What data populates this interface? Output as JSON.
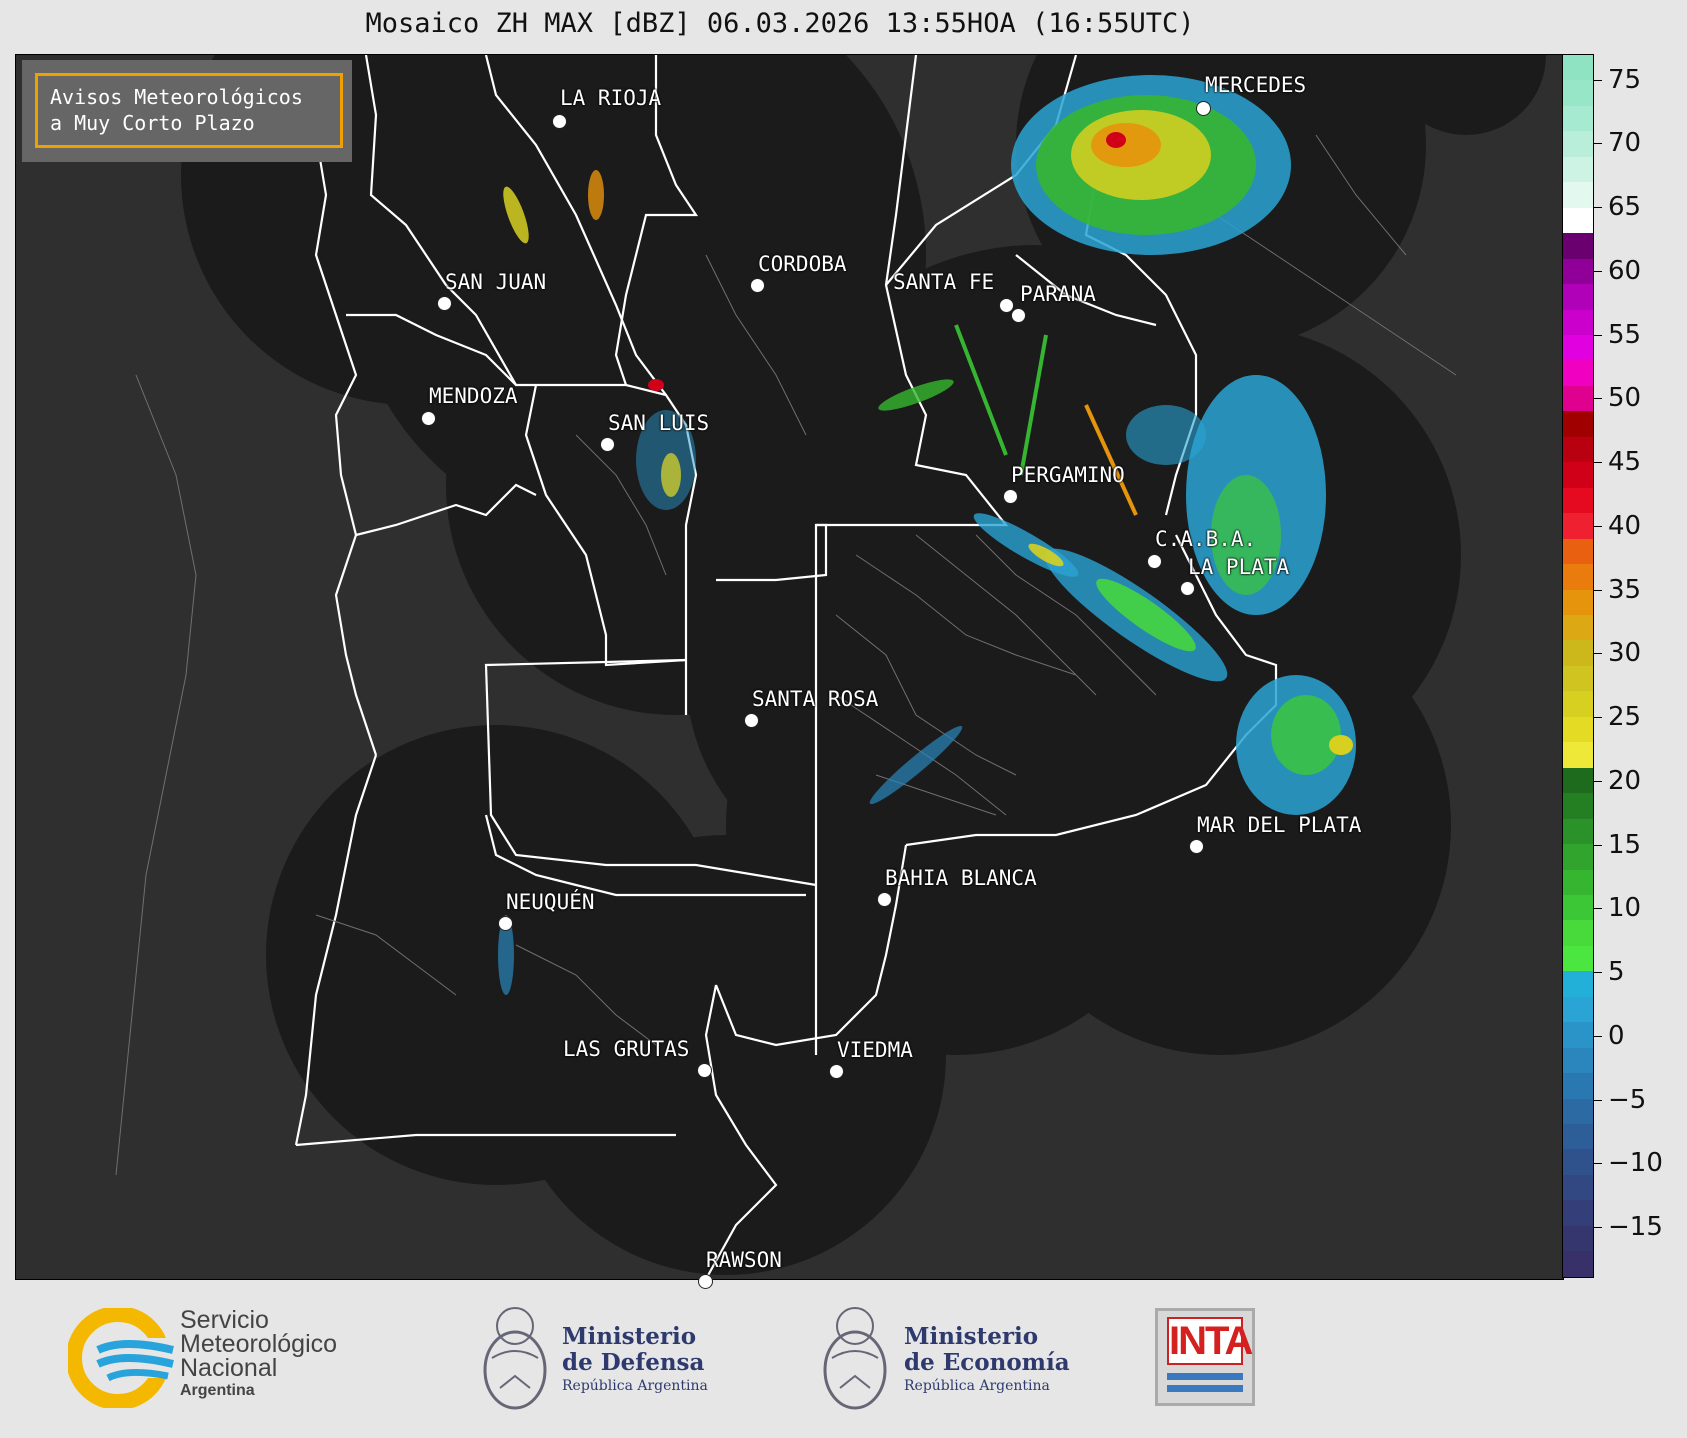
{
  "title": "Mosaico ZH MAX [dBZ] 06.03.2026 13:55HOA (16:55UTC)",
  "avisos": {
    "line1": "Avisos Meteorológicos",
    "line2": "a Muy Corto Plazo"
  },
  "cities": [
    {
      "name": "LA RIOJA",
      "id": "la-rioja"
    },
    {
      "name": "SAN JUAN",
      "id": "san-juan"
    },
    {
      "name": "CORDOBA",
      "id": "cordoba"
    },
    {
      "name": "SANTA FE",
      "id": "santa-fe"
    },
    {
      "name": "PARANA",
      "id": "parana"
    },
    {
      "name": "MERCEDES",
      "id": "mercedes"
    },
    {
      "name": "MENDOZA",
      "id": "mendoza"
    },
    {
      "name": "SAN LUIS",
      "id": "san-luis"
    },
    {
      "name": "PERGAMINO",
      "id": "pergamino"
    },
    {
      "name": "C.A.B.A.",
      "id": "caba"
    },
    {
      "name": "LA PLATA",
      "id": "la-plata"
    },
    {
      "name": "SANTA ROSA",
      "id": "santa-rosa"
    },
    {
      "name": "MAR DEL PLATA",
      "id": "mar-del-plata"
    },
    {
      "name": "BAHIA BLANCA",
      "id": "bahia-blanca"
    },
    {
      "name": "NEUQUÉN",
      "id": "neuquen"
    },
    {
      "name": "LAS GRUTAS",
      "id": "las-grutas"
    },
    {
      "name": "VIEDMA",
      "id": "viedma"
    },
    {
      "name": "RAWSON",
      "id": "rawson"
    }
  ],
  "colorbar": {
    "ticks": [
      "75",
      "70",
      "65",
      "60",
      "55",
      "50",
      "45",
      "40",
      "35",
      "30",
      "25",
      "20",
      "15",
      "10",
      "5",
      "0",
      "−5",
      "−10",
      "−15"
    ],
    "colors": [
      "#8fe3c3",
      "#98e6c8",
      "#a6ead1",
      "#b9eeda",
      "#cdf3e4",
      "#e3f8ef",
      "#ffffff",
      "#6a0070",
      "#900098",
      "#b000b8",
      "#cc00cc",
      "#e000e0",
      "#f000c0",
      "#e00090",
      "#a00000",
      "#b80010",
      "#d00018",
      "#e60a20",
      "#ef2030",
      "#e86010",
      "#ea7c0e",
      "#e6940c",
      "#dca814",
      "#ccb81a",
      "#cfc420",
      "#d8d020",
      "#e4dc24",
      "#eee838",
      "#1e6b1e",
      "#247e22",
      "#2a9228",
      "#30a42c",
      "#36b630",
      "#3cc836",
      "#48da3a",
      "#4ce640",
      "#22b0d8",
      "#2aa4d4",
      "#2a94c8",
      "#2a86bc",
      "#2a78b2",
      "#2c6aa4",
      "#2e5e98",
      "#30528c",
      "#324882",
      "#343e78",
      "#36366e",
      "#383068"
    ]
  },
  "logos": {
    "smn": {
      "line1": "Servicio",
      "line2": "Meteorológico",
      "line3": "Nacional",
      "line4": "Argentina"
    },
    "defensa": {
      "line1": "Ministerio",
      "line2": "de Defensa",
      "line3": "República Argentina"
    },
    "economia": {
      "line1": "Ministerio",
      "line2": "de Economía",
      "line3": "República Argentina"
    },
    "inta": {
      "word": "INTA"
    }
  }
}
